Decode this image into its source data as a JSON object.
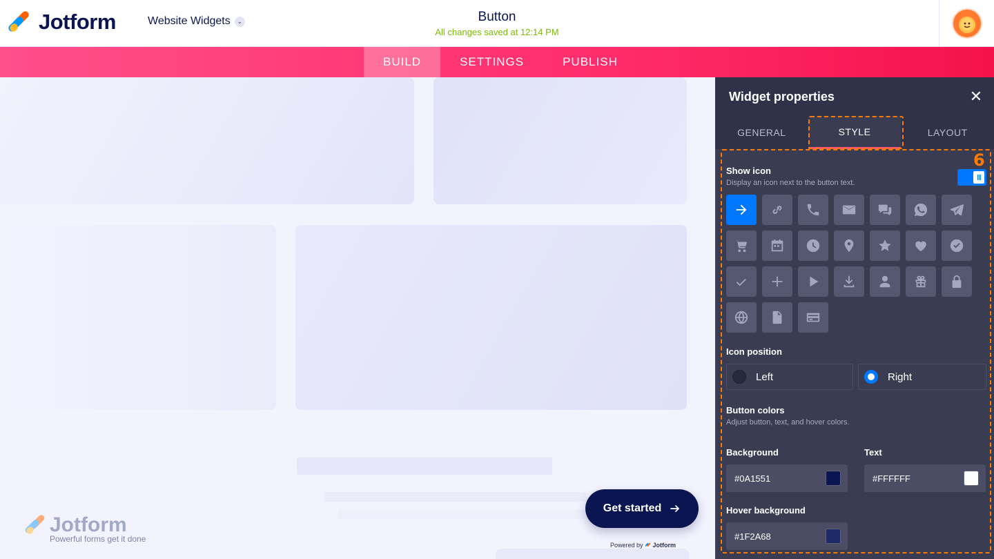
{
  "header": {
    "brand": "Jotform",
    "app_selector": "Website Widgets",
    "doc_title": "Button",
    "save_status": "All changes saved at 12:14 PM"
  },
  "nav": {
    "tabs": [
      {
        "label": "BUILD",
        "active": true
      },
      {
        "label": "SETTINGS",
        "active": false
      },
      {
        "label": "PUBLISH",
        "active": false
      }
    ]
  },
  "canvas": {
    "watermark_brand": "Jotform",
    "watermark_tagline": "Powerful forms get it done",
    "cta_label": "Get started",
    "powered_by": "Powered by",
    "powered_brand": "Jotform"
  },
  "panel": {
    "title": "Widget properties",
    "tabs": [
      {
        "label": "GENERAL",
        "active": false
      },
      {
        "label": "STYLE",
        "active": true
      },
      {
        "label": "LAYOUT",
        "active": false
      }
    ],
    "annotation_number": "6",
    "show_icon": {
      "label": "Show icon",
      "description": "Display an icon next to the button text.",
      "enabled": true
    },
    "icons": [
      "arrow-right-icon",
      "link-icon",
      "phone-icon",
      "mail-icon",
      "chat-icon",
      "whatsapp-icon",
      "telegram-icon",
      "cart-icon",
      "calendar-icon",
      "clock-icon",
      "location-pin-icon",
      "star-icon",
      "heart-icon",
      "check-circle-icon",
      "check-icon",
      "plus-icon",
      "play-icon",
      "download-icon",
      "user-icon",
      "gift-icon",
      "lock-icon",
      "globe-icon",
      "document-icon",
      "credit-card-icon"
    ],
    "selected_icon": "arrow-right-icon",
    "icon_position": {
      "label": "Icon position",
      "options": [
        "Left",
        "Right"
      ],
      "selected": "Right"
    },
    "button_colors": {
      "label": "Button colors",
      "description": "Adjust button, text, and hover colors.",
      "background_label": "Background",
      "background_value": "#0A1551",
      "text_label": "Text",
      "text_value": "#FFFFFF",
      "hover_label": "Hover background",
      "hover_value": "#1F2A68"
    }
  },
  "colors": {
    "brand_navy": "#0a1551",
    "nav_pink": "#ff2d6b",
    "panel_bg": "#3a3d52",
    "accent_blue": "#0077ff",
    "annotation_orange": "#ff7a00",
    "save_green": "#78bb07"
  }
}
